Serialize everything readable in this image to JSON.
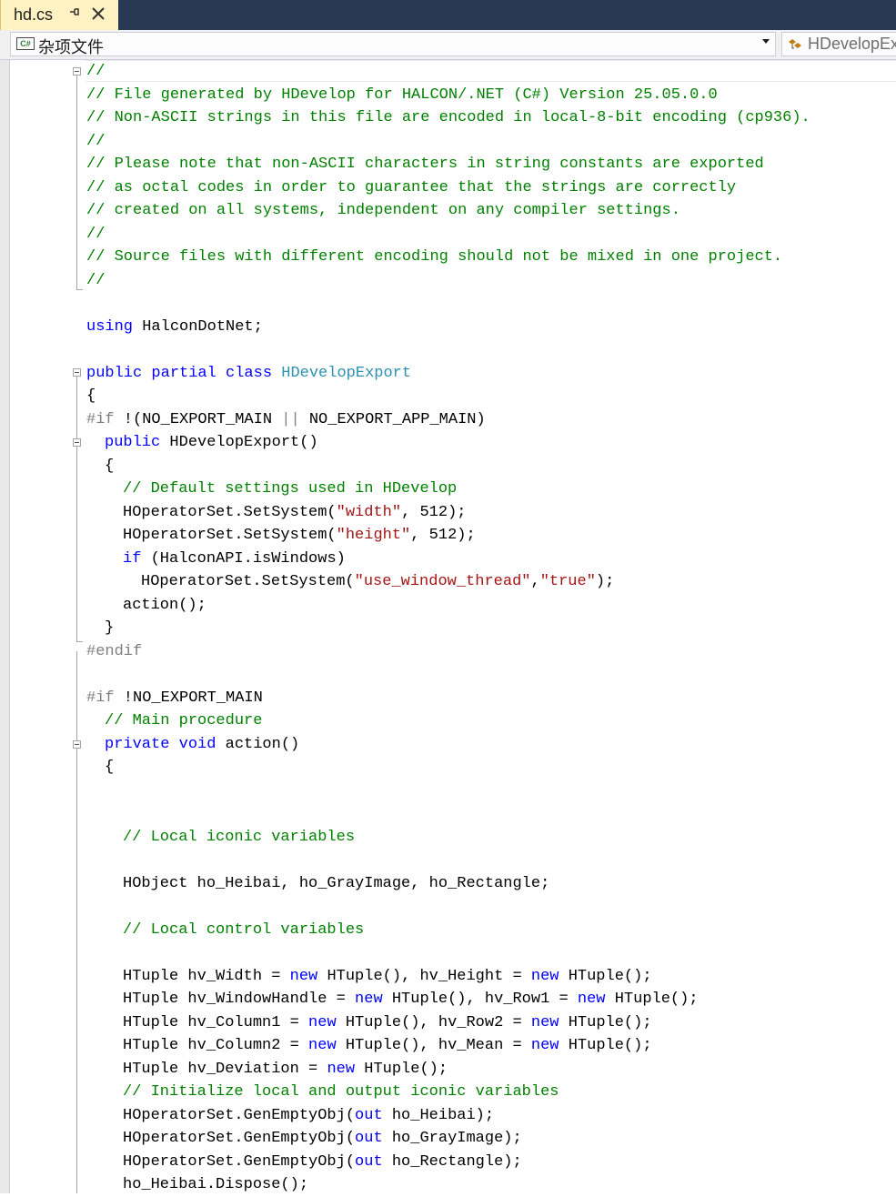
{
  "tab": {
    "title": "hd.cs"
  },
  "navbar": {
    "project": "杂项文件",
    "project_icon": "C#",
    "type": "HDevelopExport"
  },
  "code": {
    "l1": "//",
    "l2": "// File generated by HDevelop for HALCON/.NET (C#) Version 25.05.0.0",
    "l3": "// Non-ASCII strings in this file are encoded in local-8-bit encoding (cp936).",
    "l4": "//",
    "l5": "// Please note that non-ASCII characters in string constants are exported",
    "l6": "// as octal codes in order to guarantee that the strings are correctly",
    "l7": "// created on all systems, independent on any compiler settings.",
    "l8": "//",
    "l9": "// Source files with different encoding should not be mixed in one project.",
    "l10": "//",
    "using_kw": "using",
    "using_rest": " HalconDotNet;",
    "class_kw": "public partial class",
    "class_name": "HDevelopExport",
    "open_brace": "{",
    "if1_pp": "#if",
    "if1_mid": " !(NO_EXPORT_MAIN ",
    "if1_or": "||",
    "if1_end": " NO_EXPORT_APP_MAIN)",
    "ctor_kw": "public",
    "ctor_rest": " HDevelopExport()",
    "ctor_open": "{",
    "c_default": "// Default settings used in HDevelop",
    "ss1_a": "HOperatorSet.SetSystem(",
    "ss1_s": "\"width\"",
    "ss1_b": ", 512);",
    "ss2_a": "HOperatorSet.SetSystem(",
    "ss2_s": "\"height\"",
    "ss2_b": ", 512);",
    "if2_kw": "if",
    "if2_rest": " (HalconAPI.isWindows)",
    "ss3_a": "HOperatorSet.SetSystem(",
    "ss3_s1": "\"use_window_thread\"",
    "ss3_mid": ",",
    "ss3_s2": "\"true\"",
    "ss3_b": ");",
    "action_call": "action();",
    "ctor_close": "}",
    "endif": "#endif",
    "if3_pp": "#if",
    "if3_rest": " !NO_EXPORT_MAIN",
    "c_main": "// Main procedure",
    "action_kw": "private void",
    "action_rest": " action()",
    "action_open": "{",
    "c_iconic": "// Local iconic variables",
    "hobject": "HObject ho_Heibai, ho_GrayImage, ho_Rectangle;",
    "c_control": "// Local control variables",
    "ht1_a": "HTuple hv_Width = ",
    "ht1_b": " HTuple(), hv_Height = ",
    "ht1_c": " HTuple();",
    "ht2_a": "HTuple hv_WindowHandle = ",
    "ht2_b": " HTuple(), hv_Row1 = ",
    "ht2_c": " HTuple();",
    "ht3_a": "HTuple hv_Column1 = ",
    "ht3_b": " HTuple(), hv_Row2 = ",
    "ht3_c": " HTuple();",
    "ht4_a": "HTuple hv_Column2 = ",
    "ht4_b": " HTuple(), hv_Mean = ",
    "ht4_c": " HTuple();",
    "ht5_a": "HTuple hv_Deviation = ",
    "ht5_b": " HTuple();",
    "new_kw": "new",
    "c_init": "// Initialize local and output iconic variables",
    "ge1_a": "HOperatorSet.GenEmptyObj(",
    "ge1_b": " ho_Heibai);",
    "ge2_a": "HOperatorSet.GenEmptyObj(",
    "ge2_b": " ho_GrayImage);",
    "ge3_a": "HOperatorSet.GenEmptyObj(",
    "ge3_b": " ho_Rectangle);",
    "out_kw": "out",
    "dispose": "ho_Heibai.Dispose();"
  }
}
